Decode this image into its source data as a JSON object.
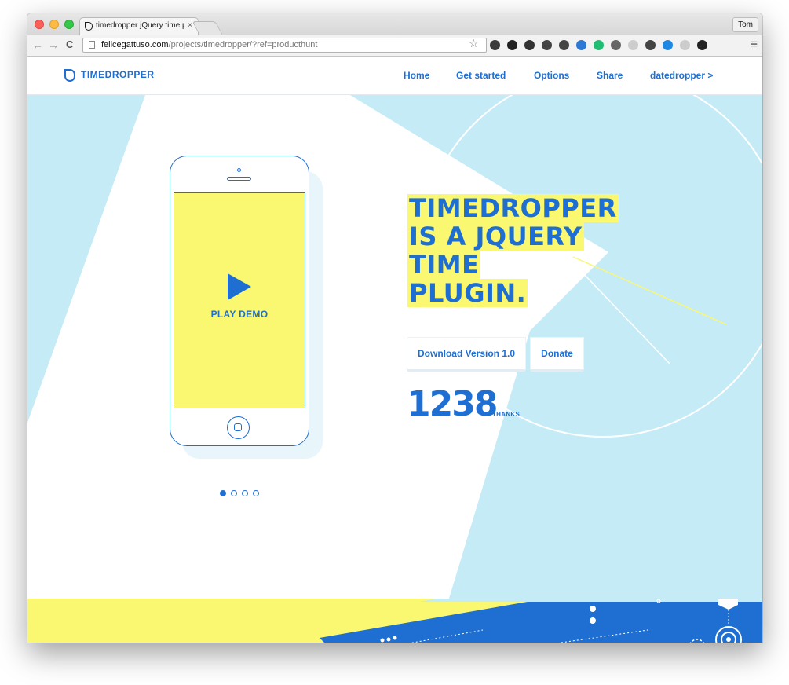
{
  "browser": {
    "tab_title": "timedropper jQuery time pi",
    "tab_close": "×",
    "profile_name": "Tom",
    "url_domain": "felicegattuso.com",
    "url_path": "/projects/timedropper/?ref=producthunt",
    "back_glyph": "←",
    "forward_glyph": "→",
    "reload_glyph": "C",
    "star_glyph": "☆",
    "menu_glyph": "≡",
    "extensions": [
      {
        "icon": "1password-icon",
        "color": "#3a3a3a"
      },
      {
        "icon": "buffer-icon",
        "color": "#222222"
      },
      {
        "icon": "evernote-icon",
        "color": "#333333"
      },
      {
        "icon": "pocket-icon",
        "color": "#444444"
      },
      {
        "icon": "shield-icon",
        "color": "#444444"
      },
      {
        "icon": "ghostery-icon",
        "color": "#2c7ad6"
      },
      {
        "icon": "grammarly-icon",
        "color": "#1fbf73"
      },
      {
        "icon": "extension-icon",
        "color": "#666666"
      },
      {
        "icon": "drive-icon",
        "color": "#cccccc"
      },
      {
        "icon": "mail-icon",
        "color": "#444444"
      },
      {
        "icon": "chrome-cast-icon",
        "color": "#1e88e5"
      },
      {
        "icon": "disabled-icon",
        "color": "#cccccc"
      },
      {
        "icon": "music-icon",
        "color": "#222222"
      }
    ]
  },
  "site": {
    "logo_text": "TIMEDROPPER",
    "nav": [
      {
        "label": "Home"
      },
      {
        "label": "Get started"
      },
      {
        "label": "Options"
      },
      {
        "label": "Share"
      },
      {
        "label": "datedropper >"
      }
    ],
    "demo_label": "PLAY DEMO",
    "headline_lines": [
      "TIMEDROPPER",
      "IS A JQUERY",
      "TIME",
      "PLUGIN."
    ],
    "download_label": "Download Version 1.0",
    "donate_label": "Donate",
    "thanks_count": "1238",
    "thanks_label": "THANKS",
    "carousel_slides": 4,
    "carousel_active": 1
  },
  "colors": {
    "brand_blue": "#1e6fd1",
    "light_blue": "#c5ebf7",
    "yellow": "#faf771"
  }
}
